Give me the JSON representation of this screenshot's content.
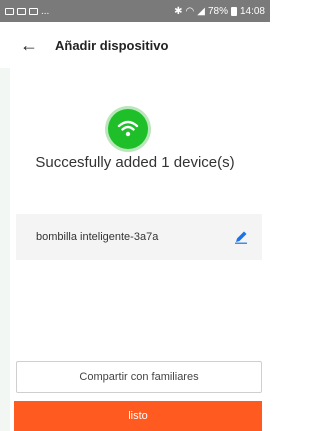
{
  "status_bar": {
    "left_text": "...",
    "right_text": "78%",
    "time": "14:08"
  },
  "header": {
    "back_icon": "back-arrow-icon",
    "title": "Añadir dispositivo"
  },
  "success": {
    "icon": "wifi-icon",
    "message": "Succesfully added 1 device(s)"
  },
  "device": {
    "name": "bombilla inteligente-3a7a",
    "edit_icon": "pencil-icon"
  },
  "actions": {
    "share_label": "Compartir con familiares",
    "done_label": "listo"
  },
  "colors": {
    "accent": "#ff5a1f",
    "success": "#1fbf2a",
    "edit": "#1a73e8"
  }
}
